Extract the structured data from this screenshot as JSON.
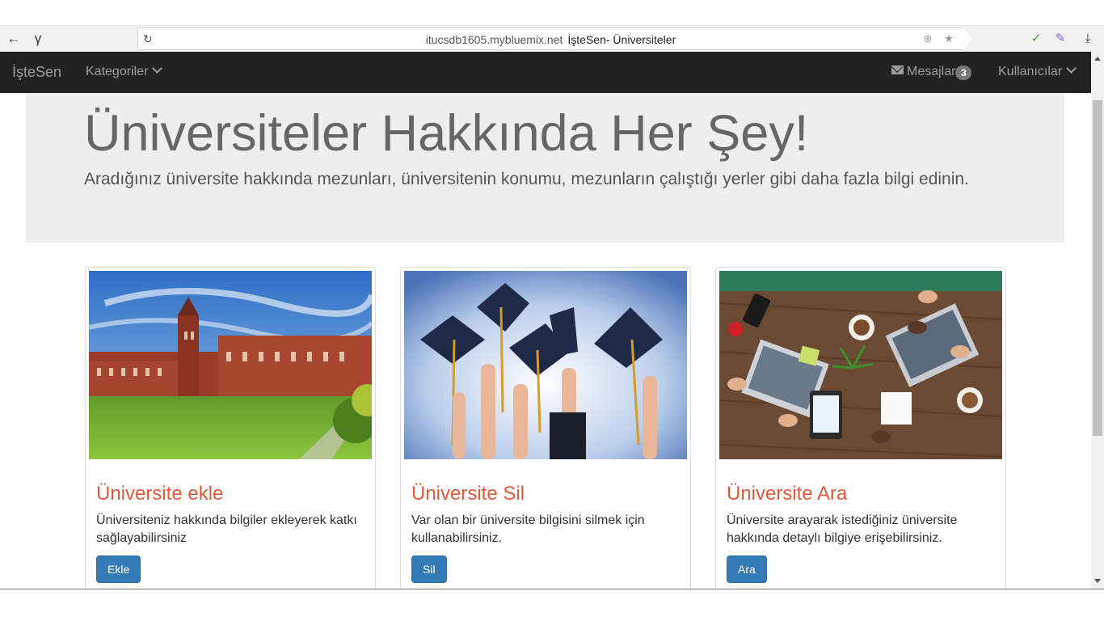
{
  "browser": {
    "back_glyph": "←",
    "forward_glyph": "γ",
    "reload_glyph": "↻",
    "url": "itucsdb1605.mybluemix.net",
    "page_title": "İşteSen- Üniversiteler",
    "translate_glyph": "⊕",
    "star_glyph": "★",
    "download_glyph": "⤓",
    "shield_glyph": "✓",
    "feather_glyph": "✎"
  },
  "navbar": {
    "brand": "İşteSen",
    "categories": "Kategoriler",
    "messages": "Mesajlar",
    "messages_count": "3",
    "users": "Kullanıcılar"
  },
  "jumbotron": {
    "title": "Üniversiteler Hakkında Her Şey!",
    "subtitle": "Aradığınız üniversite hakkında mezunları, üniversitenin konumu, mezunların çalıştığı yerler gibi daha fazla bilgi edinin."
  },
  "cards": [
    {
      "title": "Üniversite ekle",
      "description": "Üniversiteniz hakkında bilgiler ekleyerek katkı sağlayabilirsiniz",
      "button": "Ekle"
    },
    {
      "title": "Üniversite Sil",
      "description": "Var olan bir üniversite bilgisini silmek için kullanabilirsiniz.",
      "button": "Sil"
    },
    {
      "title": "Üniversite Ara",
      "description": "Üniversite arayarak istediğiniz üniversite hakkında detaylı bilgiye erişebilirsiniz.",
      "button": "Ara"
    }
  ],
  "colors": {
    "navbar_bg": "#222222",
    "accent_title": "#e0593a",
    "button": "#337ab7"
  }
}
